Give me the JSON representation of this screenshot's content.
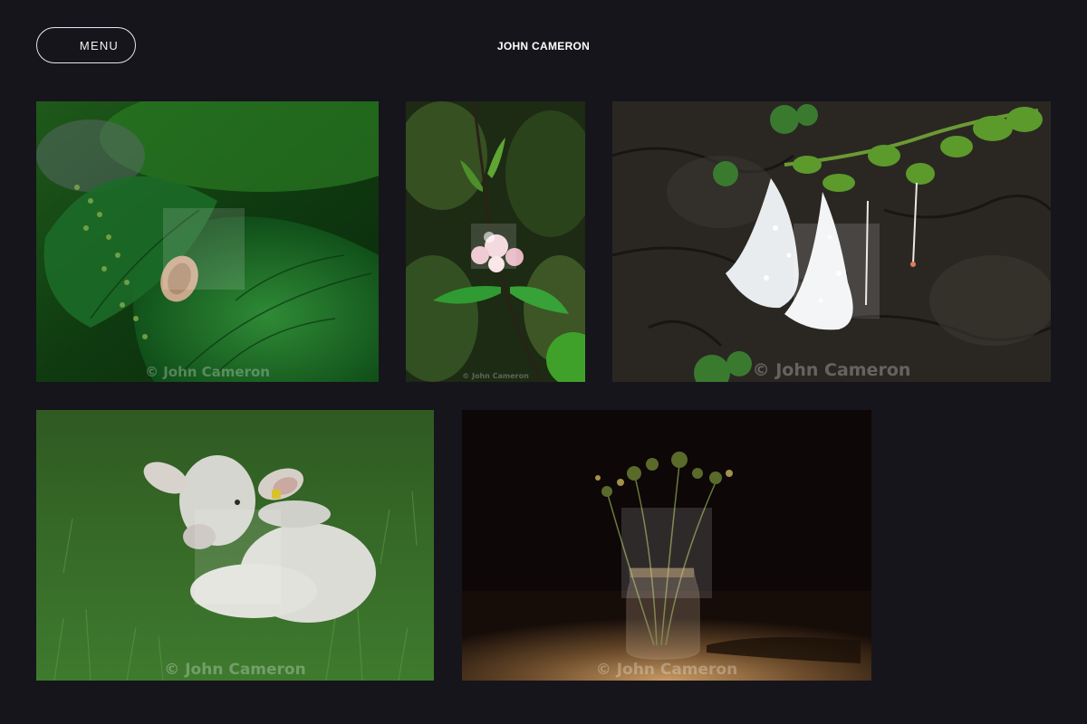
{
  "header": {
    "menu_label": "MENU",
    "site_title": "JOHN CAMERON"
  },
  "gallery": {
    "photos": [
      {
        "subject": "nettle leaf with dried seed pod",
        "watermark": "© John Cameron"
      },
      {
        "subject": "apple blossom buds",
        "watermark": "© John Cameron"
      },
      {
        "subject": "white bell flowers with raindrops",
        "watermark": "© John Cameron"
      },
      {
        "subject": "lamb resting in grass",
        "watermark": "© John Cameron"
      },
      {
        "subject": "wildflowers in glass jar",
        "watermark": "© John Cameron"
      }
    ]
  },
  "colors": {
    "background": "#16151b",
    "text": "#ffffff"
  }
}
